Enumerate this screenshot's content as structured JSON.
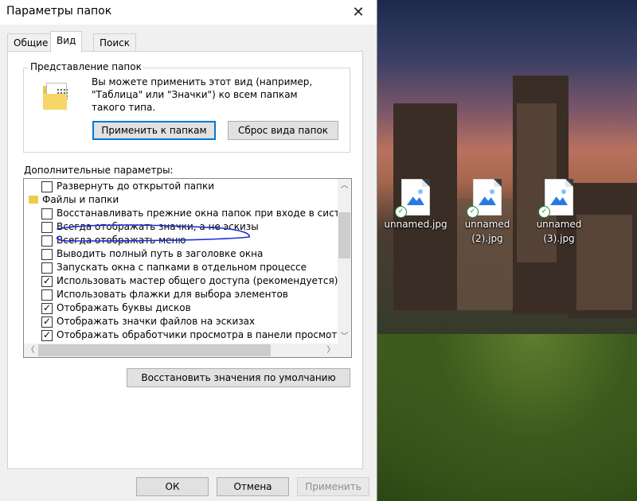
{
  "dialog": {
    "title": "Параметры папок",
    "close_glyph": "✕",
    "tabs": [
      {
        "label": "Общие",
        "active": false
      },
      {
        "label": "Вид",
        "active": true
      },
      {
        "label": "Поиск",
        "active": false
      }
    ],
    "folder_view": {
      "title": "Представление папок",
      "description": "Вы можете применить этот вид (например, \"Таблица\" или \"Значки\") ко всем папкам такого типа.",
      "apply_button": "Применить к папкам",
      "reset_button": "Сброс вида папок"
    },
    "advanced": {
      "label": "Дополнительные параметры:",
      "items": [
        {
          "type": "checkbox",
          "label": "Развернуть до открытой папки",
          "checked": false
        },
        {
          "type": "folder",
          "label": "Файлы и папки"
        },
        {
          "type": "checkbox",
          "label": "Восстанавливать прежние окна папок при входе в систе",
          "checked": false
        },
        {
          "type": "checkbox",
          "label": "Всегда отображать значки, а не эскизы",
          "checked": false
        },
        {
          "type": "checkbox",
          "label": "Всегда отображать меню",
          "checked": false
        },
        {
          "type": "checkbox",
          "label": "Выводить полный путь в заголовке окна",
          "checked": false
        },
        {
          "type": "checkbox",
          "label": "Запускать окна с папками в отдельном процессе",
          "checked": false
        },
        {
          "type": "checkbox",
          "label": "Использовать мастер общего доступа (рекомендуется)",
          "checked": true
        },
        {
          "type": "checkbox",
          "label": "Использовать флажки для выбора элементов",
          "checked": false
        },
        {
          "type": "checkbox",
          "label": "Отображать буквы дисков",
          "checked": true
        },
        {
          "type": "checkbox",
          "label": "Отображать значки файлов на эскизах",
          "checked": true
        },
        {
          "type": "checkbox",
          "label": "Отображать обработчики просмотра в панели просмотра",
          "checked": true
        }
      ],
      "restore_button": "Восстановить значения по умолчанию"
    },
    "footer": {
      "ok": "ОК",
      "cancel": "Отмена",
      "apply": "Применить"
    }
  },
  "desktop": {
    "icons": [
      {
        "label_line1": "unnamed.jpg",
        "label_line2": ""
      },
      {
        "label_line1": "unnamed",
        "label_line2": "(2).jpg"
      },
      {
        "label_line1": "unnamed",
        "label_line2": "(3).jpg"
      }
    ],
    "sync_status_icon": "green-check-icon"
  },
  "colors": {
    "accent": "#0078d7",
    "annotation": "#1a2fd6"
  }
}
